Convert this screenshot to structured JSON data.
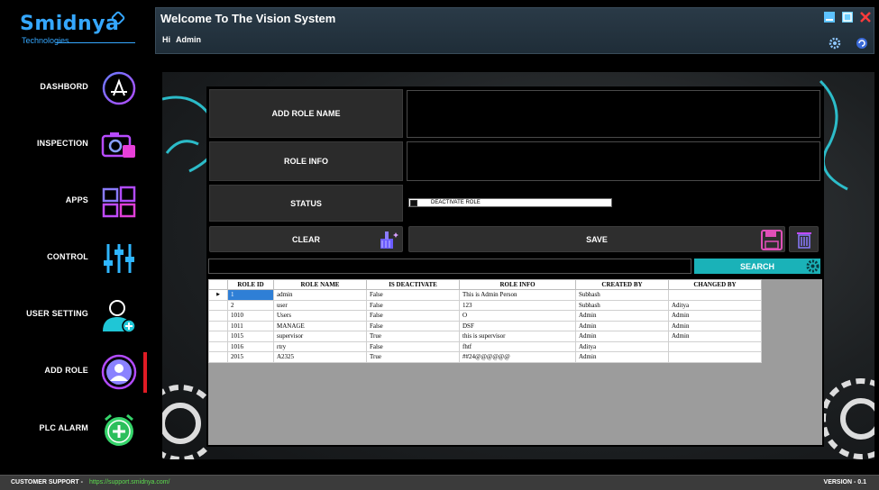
{
  "brand": {
    "name": "Smidnya",
    "tagline": "Technologies"
  },
  "header": {
    "title": "Welcome To The Vision System",
    "greeting": "Hi",
    "user": "Admin"
  },
  "sidebar": {
    "items": [
      {
        "label": "DASHBORD",
        "icon": "app-store-icon"
      },
      {
        "label": "INSPECTION",
        "icon": "camera-icon"
      },
      {
        "label": "APPS",
        "icon": "windows-icon"
      },
      {
        "label": "CONTROL",
        "icon": "sliders-icon"
      },
      {
        "label": "USER  SETTING",
        "icon": "add-user-icon"
      },
      {
        "label": "ADD ROLE",
        "icon": "user-circle-icon"
      },
      {
        "label": "PLC ALARM",
        "icon": "alarm-clock-icon"
      }
    ],
    "active": "ADD ROLE"
  },
  "form": {
    "role_name_label": "ADD ROLE NAME",
    "role_info_label": "ROLE INFO",
    "status_label": "STATUS",
    "deactivate_label": "DEACTIVATE ROLE",
    "clear_label": "CLEAR",
    "save_label": "SAVE",
    "search_label": "SEARCH"
  },
  "grid": {
    "columns": [
      "ROLE ID",
      "ROLE NAME",
      "IS DEACTIVATE",
      "ROLE INFO",
      "CREATED BY",
      "CHANGED BY"
    ],
    "rows": [
      [
        "1",
        "admin",
        "False",
        "This is Admin Person",
        "Subhash",
        ""
      ],
      [
        "2",
        "user",
        "False",
        "123",
        "Subhash",
        "Aditya"
      ],
      [
        "1010",
        "Users",
        "False",
        "O",
        "Admin",
        "Admin"
      ],
      [
        "1011",
        "MANAGE",
        "False",
        "DSF",
        "Admin",
        "Admin"
      ],
      [
        "1015",
        "supervisor",
        "True",
        "this is supervisor",
        "Admin",
        "Admin"
      ],
      [
        "1016",
        "rtry",
        "False",
        "fhtf",
        "Aditya",
        ""
      ],
      [
        "2015",
        "A2325",
        "True",
        "##24@@@@@@",
        "Admin",
        ""
      ]
    ],
    "selected_row": 0
  },
  "footer": {
    "support_label": "CUSTOMER SUPPORT -",
    "support_link": "https://support.smidnya.com/",
    "version": "VERSION - 0.1"
  },
  "colors": {
    "accent": "#1ab2b8",
    "active_marker": "#e01b24",
    "brand": "#35a7ff"
  }
}
